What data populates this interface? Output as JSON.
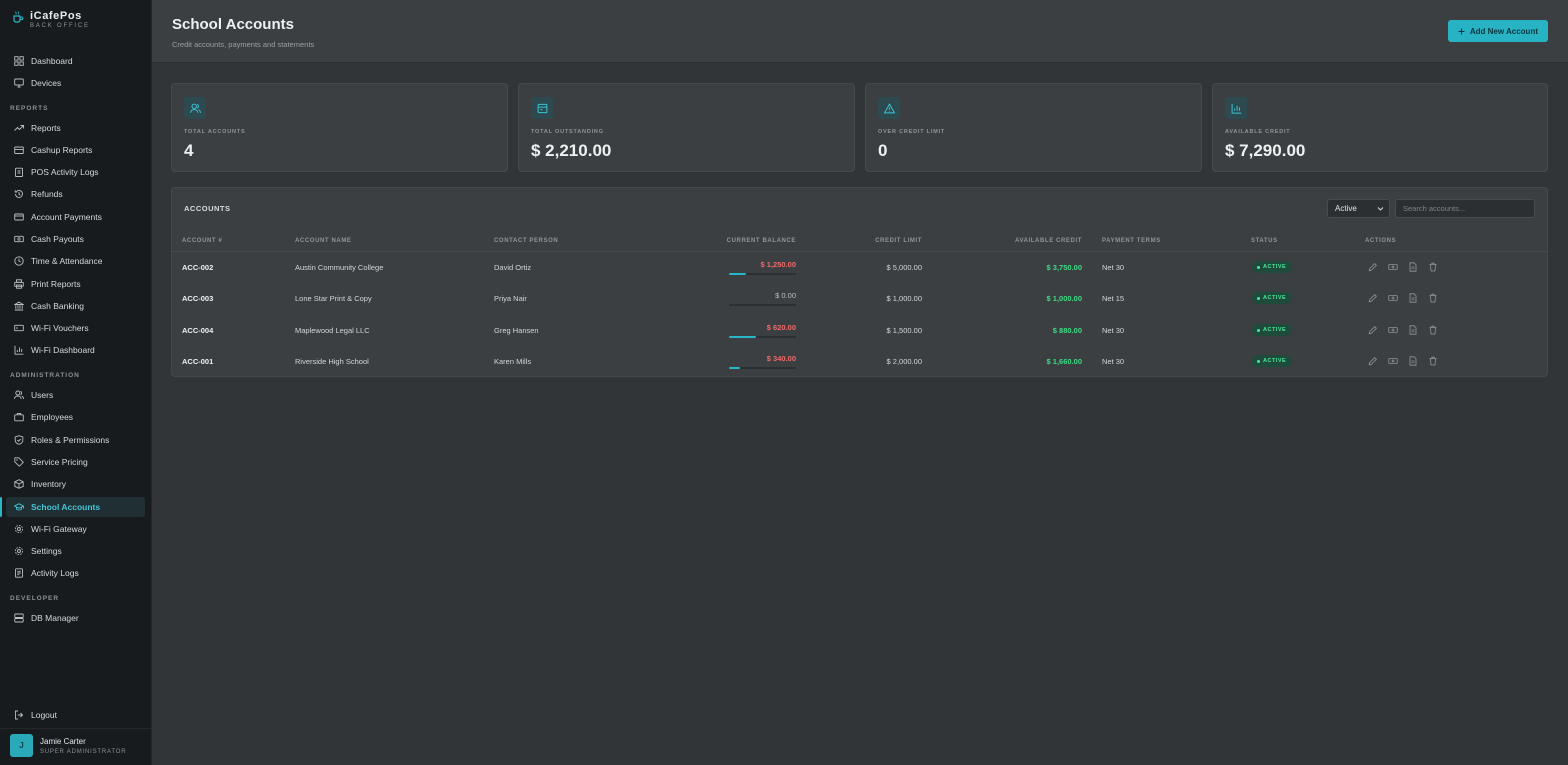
{
  "app": {
    "name": "iCafePos",
    "subtitle": "BACK OFFICE"
  },
  "sidebar": {
    "sections": {
      "reports": "REPORTS",
      "administration": "ADMINISTRATION",
      "developer": "DEVELOPER"
    },
    "items": {
      "dashboard": "Dashboard",
      "devices": "Devices",
      "reports": "Reports",
      "cashup": "Cashup Reports",
      "pos_logs": "POS Activity Logs",
      "refunds": "Refunds",
      "account_payments": "Account Payments",
      "cash_payouts": "Cash Payouts",
      "time_attendance": "Time & Attendance",
      "print_reports": "Print Reports",
      "cash_banking": "Cash Banking",
      "wifi_vouchers": "Wi-Fi Vouchers",
      "wifi_dashboard": "Wi-Fi Dashboard",
      "users": "Users",
      "employees": "Employees",
      "roles": "Roles & Permissions",
      "service_pricing": "Service Pricing",
      "inventory": "Inventory",
      "school_accounts": "School Accounts",
      "wifi_gateway": "Wi-Fi Gateway",
      "settings": "Settings",
      "activity_logs": "Activity Logs",
      "db_manager": "DB Manager"
    },
    "logout": "Logout",
    "user": {
      "initial": "J",
      "name": "Jamie Carter",
      "role": "SUPER ADMINISTRATOR"
    }
  },
  "header": {
    "title": "School Accounts",
    "subtitle": "Credit accounts, payments and statements",
    "add_button": "Add New Account"
  },
  "stats": [
    {
      "label": "TOTAL ACCOUNTS",
      "value": "4",
      "icon": "users-icon"
    },
    {
      "label": "TOTAL OUTSTANDING",
      "value": "$ 2,210.00",
      "icon": "wallet-icon"
    },
    {
      "label": "OVER CREDIT LIMIT",
      "value": "0",
      "icon": "alert-icon"
    },
    {
      "label": "AVAILABLE CREDIT",
      "value": "$ 7,290.00",
      "icon": "bar-chart-icon"
    }
  ],
  "accounts": {
    "title": "ACCOUNTS",
    "filter": "Active",
    "search_placeholder": "Search accounts...",
    "columns": [
      "ACCOUNT #",
      "ACCOUNT NAME",
      "CONTACT PERSON",
      "CURRENT BALANCE",
      "CREDIT LIMIT",
      "AVAILABLE CREDIT",
      "PAYMENT TERMS",
      "STATUS",
      "ACTIONS"
    ],
    "rows": [
      {
        "id": "ACC-002",
        "name": "Austin Community College",
        "contact": "David Ortiz",
        "balance": "$ 1,250.00",
        "utilization": 0.25,
        "limit": "$ 5,000.00",
        "available": "$ 3,750.00",
        "terms": "Net 30",
        "status": "ACTIVE"
      },
      {
        "id": "ACC-003",
        "name": "Lone Star Print & Copy",
        "contact": "Priya Nair",
        "balance": "$ 0.00",
        "utilization": 0,
        "limit": "$ 1,000.00",
        "available": "$ 1,000.00",
        "terms": "Net 15",
        "status": "ACTIVE"
      },
      {
        "id": "ACC-004",
        "name": "Maplewood Legal LLC",
        "contact": "Greg Hansen",
        "balance": "$ 620.00",
        "utilization": 0.41,
        "limit": "$ 1,500.00",
        "available": "$ 880.00",
        "terms": "Net 30",
        "status": "ACTIVE"
      },
      {
        "id": "ACC-001",
        "name": "Riverside High School",
        "contact": "Karen Mills",
        "balance": "$ 340.00",
        "utilization": 0.17,
        "limit": "$ 2,000.00",
        "available": "$ 1,660.00",
        "terms": "Net 30",
        "status": "ACTIVE"
      }
    ]
  },
  "colors": {
    "accent": "#29b6c8",
    "negative": "#f06a6a",
    "positive": "#3ddc84"
  }
}
